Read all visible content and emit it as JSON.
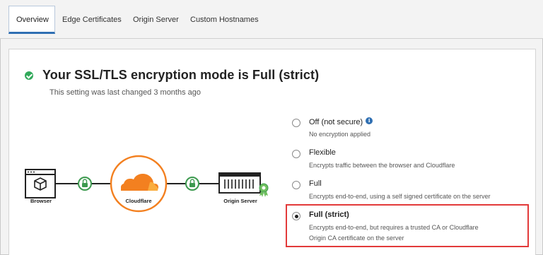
{
  "tabs": [
    {
      "label": "Overview",
      "active": true
    },
    {
      "label": "Edge Certificates"
    },
    {
      "label": "Origin Server"
    },
    {
      "label": "Custom Hostnames"
    }
  ],
  "header": {
    "title": "Your SSL/TLS encryption mode is Full (strict)",
    "subtitle": "This setting was last changed 3 months ago"
  },
  "diagram": {
    "browser_label": "Browser",
    "cloudflare_label": "Cloudflare",
    "origin_label": "Origin Server"
  },
  "options": [
    {
      "label": "Off (not secure)",
      "desc": "No encryption applied",
      "selected": false
    },
    {
      "label": "Flexible",
      "desc": "Encrypts traffic between the browser and Cloudflare",
      "selected": false
    },
    {
      "label": "Full",
      "desc": "Encrypts end-to-end, using a self signed certificate on the server",
      "selected": false
    },
    {
      "label": "Full (strict)",
      "desc_line1": "Encrypts end-to-end, but requires a trusted CA or Cloudflare",
      "desc_line2": "Origin CA certificate on the server",
      "selected": true
    }
  ],
  "colors": {
    "accent": "#2f6fb2",
    "success": "#31a95a",
    "cloudflare_orange": "#f38020",
    "highlight": "#e23a3a"
  }
}
